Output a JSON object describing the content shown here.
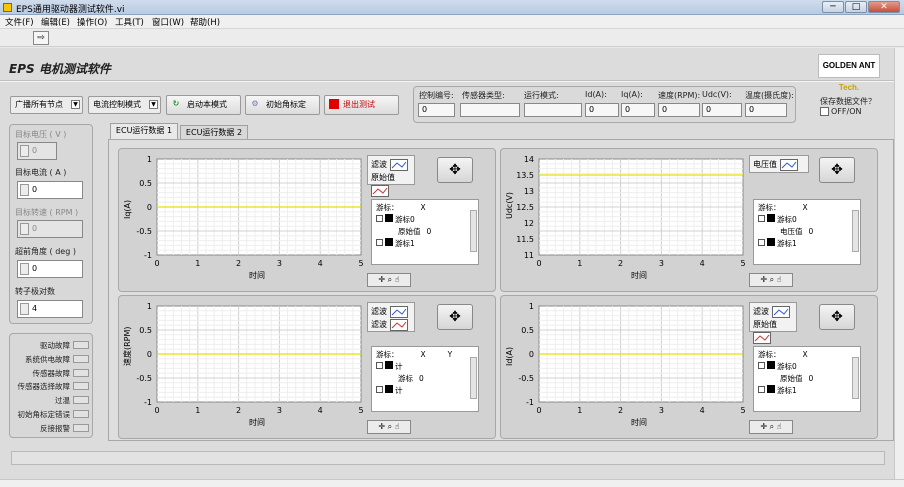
{
  "window": {
    "title": "EPS通用驱动器测试软件.vi",
    "min": "─",
    "max": "□",
    "close": "✕"
  },
  "menu": [
    "文件(F)",
    "编辑(E)",
    "操作(O)",
    "工具(T)",
    "窗口(W)",
    "帮助(H)"
  ],
  "toolbar": {
    "run_glyph": "⇨"
  },
  "app": {
    "title": "EPS 电机测试软件",
    "logo_main": "GOLDEN ANT",
    "logo_sub": "Tech."
  },
  "controls": {
    "broadcast": "广播所有节点",
    "control_mode": "电流控制模式",
    "start": "启动本模式",
    "init_angle": "初始角标定",
    "exit": "退出测试"
  },
  "status_fields": [
    {
      "label": "控制编号:",
      "value": "0"
    },
    {
      "label": "传感器类型:",
      "value": ""
    },
    {
      "label": "运行模式:",
      "value": ""
    },
    {
      "label": "Id(A):",
      "value": "0"
    },
    {
      "label": "Iq(A):",
      "value": "0"
    },
    {
      "label": "速度(RPM):",
      "value": "0"
    },
    {
      "label": "Udc(V):",
      "value": "0"
    },
    {
      "label": "温度(摄氏度):",
      "value": "0"
    }
  ],
  "save": {
    "label": "保存数据文件？",
    "toggle": "OFF/ON"
  },
  "left": {
    "target_voltage": {
      "label": "目标电压 ( V )",
      "value": "0"
    },
    "target_current": {
      "label": "目标电流 ( A )",
      "value": "0"
    },
    "target_speed": {
      "label": "目标转速 ( RPM )",
      "value": "0"
    },
    "angle": {
      "label": "超前角度 ( deg )",
      "value": "0"
    },
    "pole_pairs": {
      "label": "转子极对数",
      "value": "4"
    }
  },
  "faults": [
    "驱动故障",
    "系统供电故障",
    "传感器故障",
    "传感器选择故障",
    "过温",
    "初始角标定错误",
    "反接报警"
  ],
  "tabs": [
    "ECU运行数据 1",
    "ECU运行数据 2"
  ],
  "graphs": [
    {
      "ylabel": "Iq(A)",
      "xlabel": "时间",
      "yticks": [
        "1",
        "0.5",
        "0",
        "-0.5",
        "-1"
      ],
      "xticks": [
        "0",
        "1",
        "2",
        "3",
        "4",
        "5"
      ],
      "legend": [
        "滤波",
        "原始值"
      ],
      "cursor": {
        "h1": "游标：",
        "h2": "X",
        "rows": [
          "游标0",
          "原始值",
          "游标1"
        ],
        "val": "0"
      }
    },
    {
      "ylabel": "Udc(V)",
      "xlabel": "时间",
      "yticks": [
        "14",
        "13.5",
        "13",
        "12.5",
        "12",
        "11.5",
        "11"
      ],
      "xticks": [
        "0",
        "1",
        "2",
        "3",
        "4",
        "5"
      ],
      "legend": [
        "电压值"
      ],
      "cursor": {
        "h1": "游标：",
        "h2": "X",
        "rows": [
          "游标0",
          "电压值",
          "游标1"
        ],
        "val": "0"
      }
    },
    {
      "ylabel": "速度(RPM)",
      "xlabel": "时间",
      "yticks": [
        "1",
        "0.5",
        "0",
        "-0.5",
        "-1"
      ],
      "xticks": [
        "0",
        "1",
        "2",
        "3",
        "4",
        "5"
      ],
      "legend": [
        "滤波",
        "滤波"
      ],
      "cursor": {
        "h1": "游标：",
        "h2": "X",
        "h3": "Y",
        "rows": [
          "计",
          "游标",
          "计"
        ],
        "val": "0"
      }
    },
    {
      "ylabel": "Id(A)",
      "xlabel": "时间",
      "yticks": [
        "1",
        "0.5",
        "0",
        "-0.5",
        "-1"
      ],
      "xticks": [
        "0",
        "1",
        "2",
        "3",
        "4",
        "5"
      ],
      "legend": [
        "滤波",
        "原始值"
      ],
      "cursor": {
        "h1": "游标：",
        "h2": "X",
        "rows": [
          "游标0",
          "原始值",
          "游标1"
        ],
        "val": "0"
      }
    }
  ],
  "colors": {
    "trace": "#e8e000",
    "filter_line": "#2a5bd0",
    "raw_line": "#d03030"
  }
}
